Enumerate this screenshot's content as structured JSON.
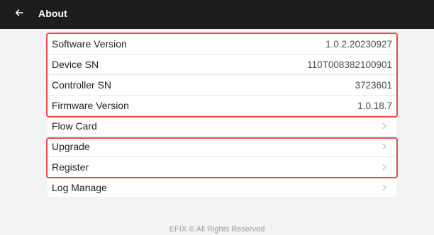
{
  "header": {
    "title": "About",
    "back_icon": "arrow-left-icon"
  },
  "info": [
    {
      "label": "Software Version",
      "value": "1.0.2.20230927"
    },
    {
      "label": "Device SN",
      "value": "110T008382100901"
    },
    {
      "label": "Controller SN",
      "value": "3723601"
    },
    {
      "label": "Firmware Version",
      "value": "1.0.18.7"
    }
  ],
  "menu": [
    {
      "label": "Flow Card",
      "icon": "chevron-right-icon"
    },
    {
      "label": "Upgrade",
      "icon": "chevron-right-icon"
    },
    {
      "label": "Register",
      "icon": "chevron-right-icon"
    },
    {
      "label": "Log Manage",
      "icon": "chevron-right-icon"
    }
  ],
  "footer": {
    "text": "EFIX © All Rights Reserved"
  },
  "colors": {
    "topbar": "#1d1d1f",
    "highlight": "#e74a4a",
    "background": "#f3f3f5"
  }
}
